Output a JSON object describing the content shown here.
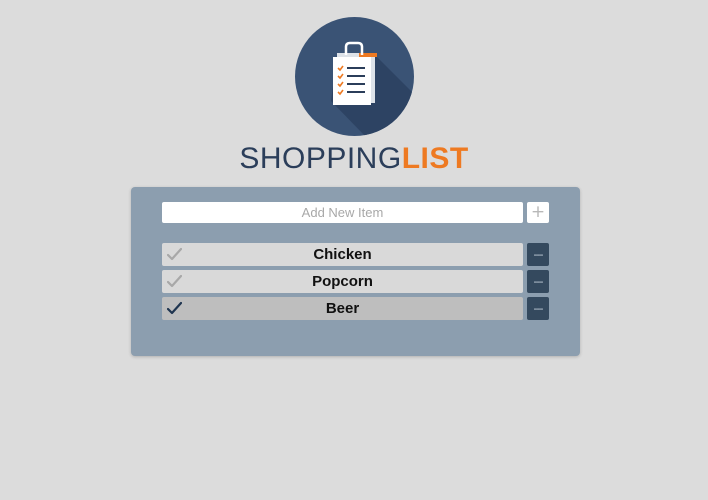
{
  "app": {
    "title_part_1": "SHOPPING",
    "title_part_2": "LIST",
    "logo_icon": "shopping-bag-checklist-icon"
  },
  "add_form": {
    "placeholder": "Add New Item",
    "value": "",
    "add_label": "+"
  },
  "items": [
    {
      "label": "Chicken",
      "checked": false,
      "remove_label": "---"
    },
    {
      "label": "Popcorn",
      "checked": false,
      "remove_label": "---"
    },
    {
      "label": "Beer",
      "checked": true,
      "remove_label": "---"
    }
  ],
  "colors": {
    "background": "#dcdcdc",
    "panel": "#8c9eaf",
    "logo_circle": "#3a5375",
    "title_dark": "#2b3e5a",
    "title_accent": "#ee7a22",
    "item_unchecked": "#d9d9d9",
    "item_checked": "#bebebe",
    "check_unchecked": "#a8a8a8",
    "check_checked": "#1f3550",
    "remove_button": "#34495e"
  }
}
